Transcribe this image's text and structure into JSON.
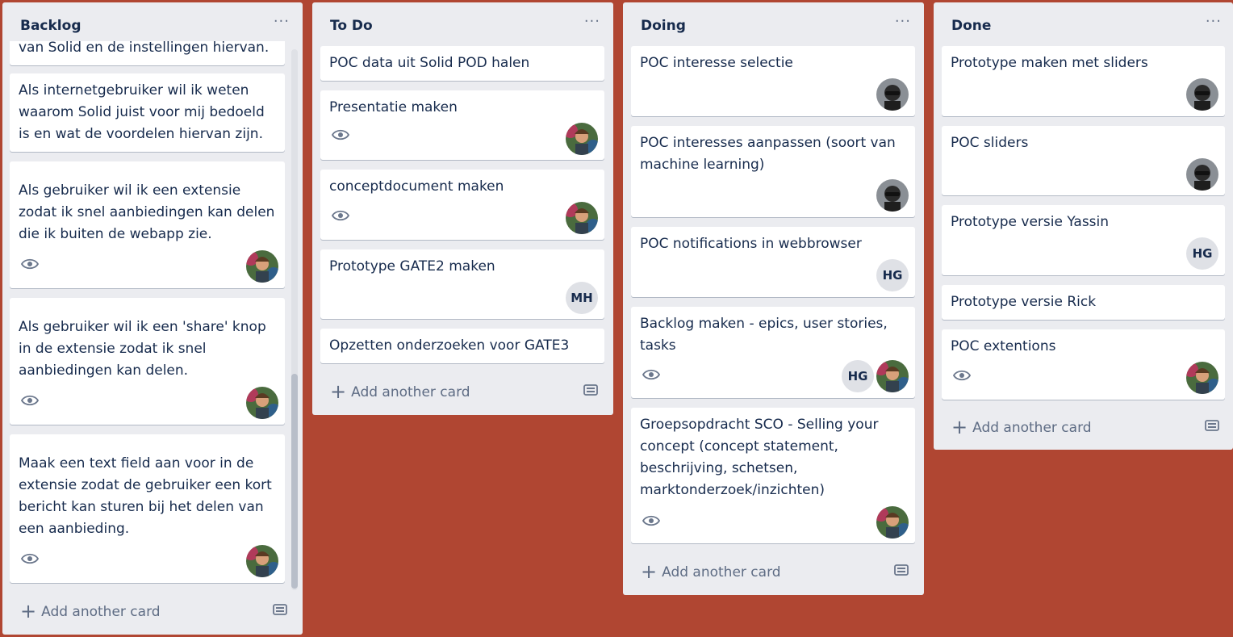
{
  "lists": [
    {
      "title": "Backlog",
      "partial_card_text": "van Solid en de instellingen hiervan.",
      "cards": [
        {
          "title": "Als internetgebruiker wil ik weten waarom Solid juist voor mij bedoeld is en wat de voordelen hiervan zijn."
        },
        {
          "title": "Als gebruiker wil ik een extensie zodat ik snel aanbiedingen kan delen die ik buiten de webapp zie."
        },
        {
          "title": "Als gebruiker wil ik een 'share' knop in de extensie zodat ik snel aanbiedingen kan delen."
        },
        {
          "title": "Maak een text field aan voor in de extensie zodat de gebruiker een kort bericht kan sturen bij het delen van een aanbieding."
        }
      ],
      "add_label": "Add another card"
    },
    {
      "title": "To Do",
      "cards": [
        {
          "title": "POC data uit Solid POD halen"
        },
        {
          "title": "Presentatie maken"
        },
        {
          "title": "conceptdocument maken"
        },
        {
          "title": "Prototype GATE2 maken",
          "initials": "MH"
        },
        {
          "title": "Opzetten onderzoeken voor GATE3"
        }
      ],
      "add_label": "Add another card"
    },
    {
      "title": "Doing",
      "cards": [
        {
          "title": "POC interesse selectie"
        },
        {
          "title": "POC interesses aanpassen (soort van machine learning)"
        },
        {
          "title": "POC notifications in webbrowser",
          "initials": "HG"
        },
        {
          "title": "Backlog maken - epics, user stories, tasks",
          "initials": "HG"
        },
        {
          "title": "Groepsopdracht SCO - Selling your concept (concept statement, beschrijving, schetsen, marktonderzoek/inzichten)"
        }
      ],
      "add_label": "Add another card"
    },
    {
      "title": "Done",
      "cards": [
        {
          "title": "Prototype maken met sliders"
        },
        {
          "title": "POC sliders"
        },
        {
          "title": "Prototype versie Yassin",
          "initials": "HG"
        },
        {
          "title": "Prototype versie Rick"
        },
        {
          "title": "POC extentions"
        }
      ],
      "add_label": "Add another card"
    }
  ],
  "menu_glyph": "···",
  "add_plus": "+",
  "colors": {
    "board_background": "#b04632",
    "list_background": "#ebecf0",
    "card_background": "#ffffff",
    "text": "#172b4d",
    "muted": "#5e6c84"
  },
  "icons": {
    "watch": "eye-icon",
    "template": "card-template-icon",
    "menu": "more-icon",
    "add": "plus-icon"
  }
}
